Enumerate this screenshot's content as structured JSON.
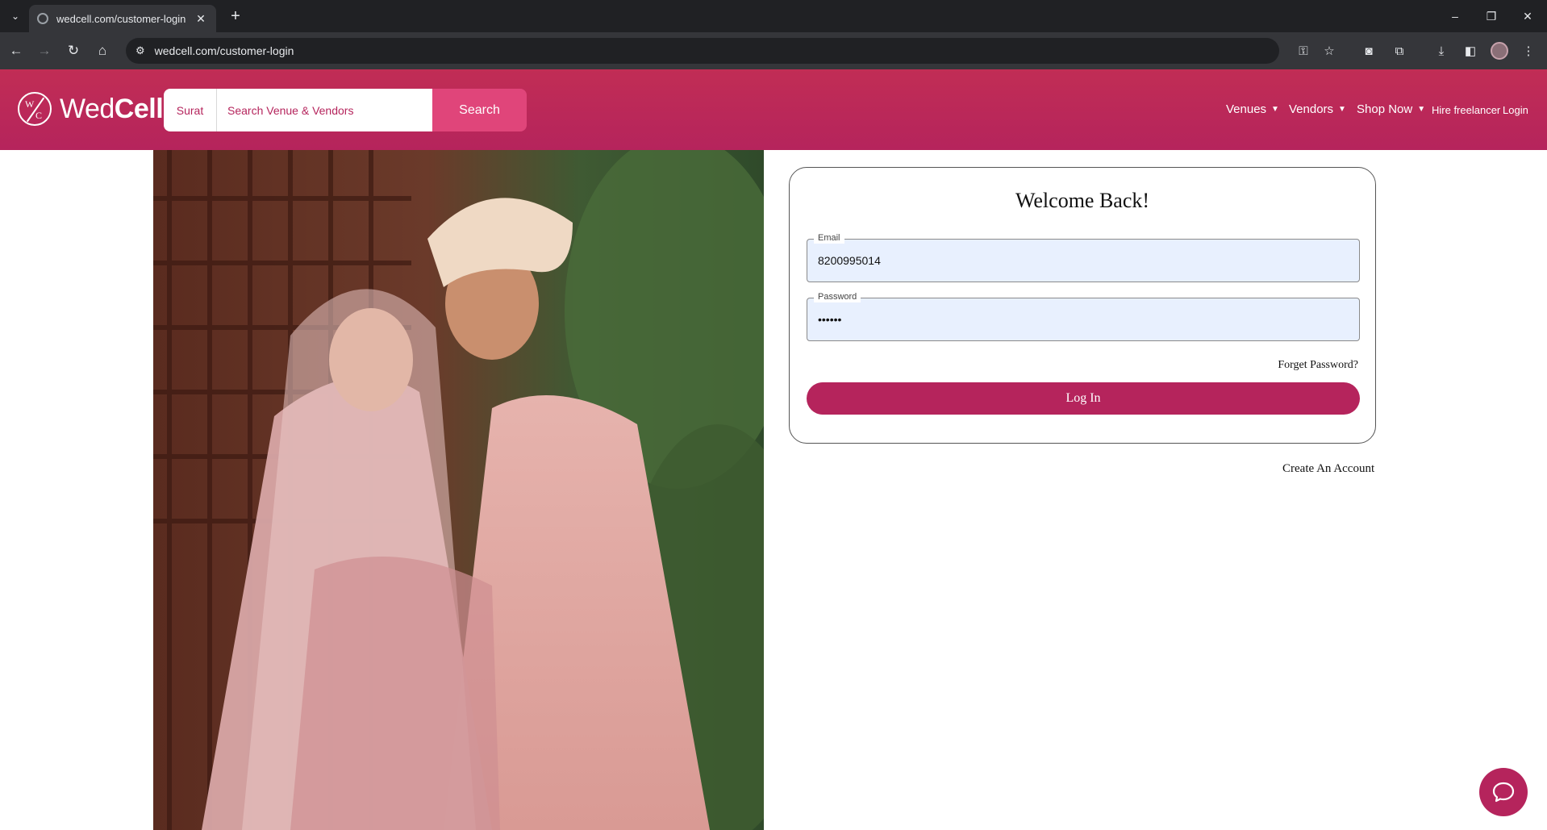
{
  "browser": {
    "tab_title": "wedcell.com/customer-login",
    "url": "wedcell.com/customer-login"
  },
  "header": {
    "logo_mark_top": "W",
    "logo_mark_bottom": "C",
    "logo_text_light": "Wed",
    "logo_text_bold": "Cell",
    "city": "Surat",
    "search_placeholder": "Search Venue & Vendors",
    "search_button": "Search",
    "nav": {
      "venues": "Venues",
      "vendors": "Vendors",
      "shop_now": "Shop Now",
      "hire_freelancer": "Hire freelancer",
      "login": "Login"
    }
  },
  "login": {
    "title": "Welcome Back!",
    "email_label": "Email",
    "email_value": "8200995014",
    "password_label": "Password",
    "password_value": "••••••",
    "forgot_password": "Forget Password?",
    "login_button": "Log In",
    "create_account": "Create An Account"
  },
  "colors": {
    "brand": "#b5245c",
    "search_button": "#e0457a",
    "autofill": "#e8f0fe"
  }
}
